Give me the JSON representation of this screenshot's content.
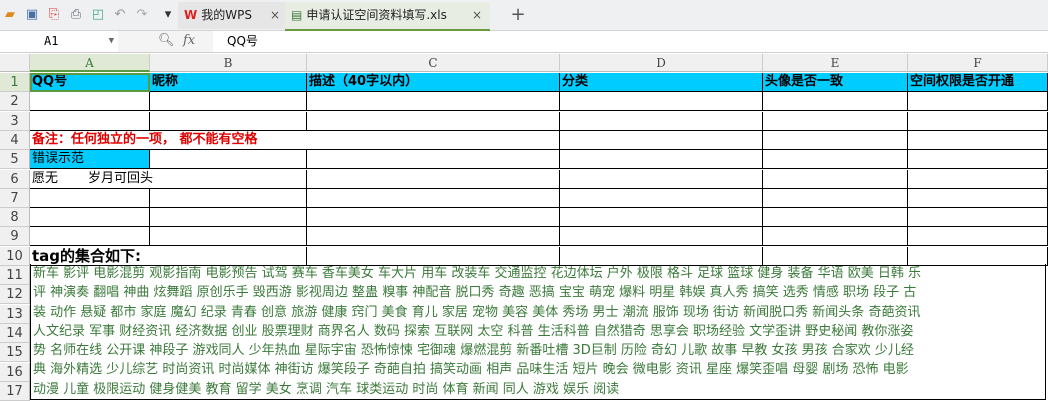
{
  "toolbar": {
    "tabs": [
      {
        "label": "我的WPS",
        "close": "×"
      },
      {
        "label": "申请认证空间资料填写.xls",
        "close": "×"
      }
    ],
    "new_tab": "+"
  },
  "formula_bar": {
    "name_box": "A1",
    "fx": "fx",
    "value": "QQ号"
  },
  "columns": [
    "A",
    "B",
    "C",
    "D",
    "E",
    "F"
  ],
  "rows": [
    "1",
    "2",
    "3",
    "4",
    "5",
    "6",
    "7",
    "8",
    "9",
    "10",
    "11",
    "12",
    "13",
    "14",
    "15",
    "16",
    "17"
  ],
  "headers": [
    "QQ号",
    "昵称",
    "描述（40字以内）",
    "分类",
    "头像是否一致",
    "空间权限是否开通"
  ],
  "note": "备注：任何独立的一项，  都不能有空格",
  "example_label": "错误示范",
  "example_row": {
    "a": "愿无",
    "b": "岁月可回头"
  },
  "tag_title": "tag的集合如下:",
  "tag_lines": [
    "新车 影评 电影混剪 观影指南 电影预告 试驾 赛车 香车美女 车大片 用车 改装车 交通监控 花边体坛 户外 极限 格斗 足球 篮球 健身 装备 华语 欧美 日韩 乐",
    "评 神演奏 翻唱 神曲 炫舞蹈 原创乐手 毁西游 影视周边 整蛊 糗事 神配音 脱口秀 奇趣 恶搞 宝宝 萌宠 爆料 明星 韩娱 真人秀 搞笑 选秀 情感 职场 段子 古",
    "装 动作 悬疑 都市 家庭 魔幻 纪录 青春 创意 旅游 健康 窍门 美食 育儿 家居 宠物 美容 美体 秀场 男士 潮流 服饰 现场 街访 新闻脱口秀 新闻头条 奇葩资讯",
    "人文纪录 军事 财经资讯 经济数据 创业 股票理财 商界名人 数码 探索 互联网 太空 科普 生活科普 自然猎奇 思享会 职场经验 文学歪讲 野史秘闻 教你涨姿",
    "势 名师在线 公开课 神段子 游戏同人 少年热血 星际宇宙 恐怖惊悚 宅御魂 爆燃混剪 新番吐槽 3D巨制 历险 奇幻 儿歌 故事 早教 女孩 男孩 合家欢 少儿经",
    "典 海外精选 少儿综艺 时尚资讯 时尚媒体 神街访 爆笑段子 奇葩自拍 搞笑动画 相声 品味生活 短片 晚会 微电影 资讯 星座 爆笑歪唱 母婴 剧场 恐怖 电影",
    "动漫 儿童 极限运动 健身健美 教育 留学 美女 烹调 汽车 球类运动 时尚 体育 新闻 同人 游戏 娱乐 阅读"
  ]
}
